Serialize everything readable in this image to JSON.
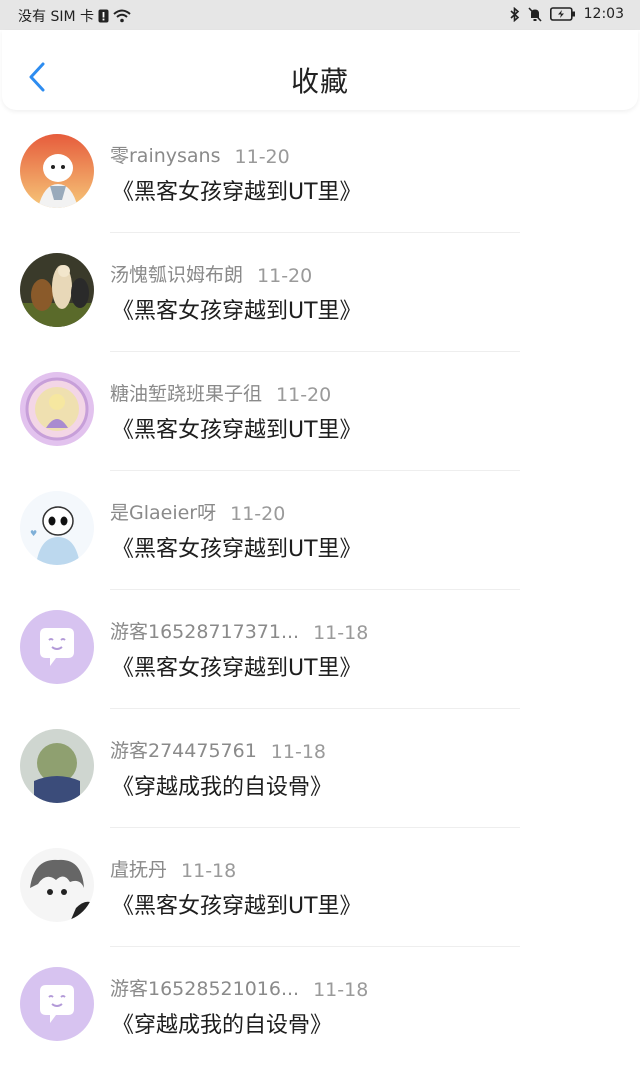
{
  "status_bar": {
    "carrier": "没有 SIM 卡",
    "time": "12:03",
    "icons": [
      "sim-alert-icon",
      "wifi-icon",
      "bluetooth-icon",
      "mute-bell-icon",
      "battery-charging-icon"
    ]
  },
  "header": {
    "title": "收藏",
    "back_icon": "chevron-left-icon",
    "accent": "#2d8cf0"
  },
  "list": [
    {
      "name": "零rainysans",
      "date": "11-20",
      "work": "《黑客女孩穿越到UT里》",
      "avatar_palette": [
        "#f4b36a",
        "#e65c3c"
      ]
    },
    {
      "name": "汤愧瓠识姆布朗",
      "date": "11-20",
      "work": "《黑客女孩穿越到UT里》",
      "avatar_palette": [
        "#3a3a2a",
        "#c8b08a"
      ]
    },
    {
      "name": "糖油堑跷班果子徂",
      "date": "11-20",
      "work": "《黑客女孩穿越到UT里》",
      "avatar_palette": [
        "#d9b5e6",
        "#f2c9d8"
      ]
    },
    {
      "name": "是Glaeier呀",
      "date": "11-20",
      "work": "《黑客女孩穿越到UT里》",
      "avatar_palette": [
        "#eef4fa",
        "#bcd8ee"
      ]
    },
    {
      "name": "游客16528717371...",
      "date": "11-18",
      "work": "《黑客女孩穿越到UT里》",
      "avatar_palette": [
        "#d7c3f0",
        "#ffffff"
      ]
    },
    {
      "name": "游客274475761",
      "date": "11-18",
      "work": "《穿越成我的自设骨》",
      "avatar_palette": [
        "#3b4c7a",
        "#9ab07a"
      ]
    },
    {
      "name": "虘抚丹",
      "date": "11-18",
      "work": "《黑客女孩穿越到UT里》",
      "avatar_palette": [
        "#f5f5f5",
        "#555555"
      ]
    },
    {
      "name": "游客16528521016...",
      "date": "11-18",
      "work": "《穿越成我的自设骨》",
      "avatar_palette": [
        "#d7c3f0",
        "#ffffff"
      ]
    }
  ]
}
